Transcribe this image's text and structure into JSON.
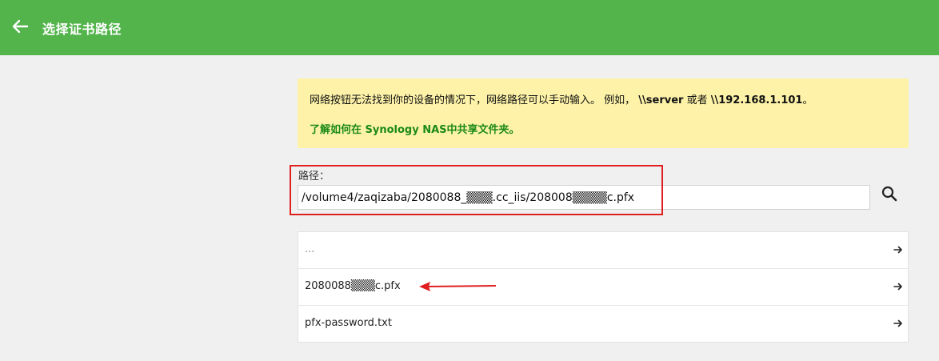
{
  "header": {
    "back_icon": "arrow-left-icon",
    "title": "选择证书路径",
    "bg_color": "#52b44b"
  },
  "notice": {
    "text_before": "网络按钮无法找到你的设备的情况下，网络路径可以手动输入。 例如， ",
    "example1": "\\\\server",
    "text_middle": " 或者 ",
    "example2": "\\\\192.168.1.101",
    "text_end": "。",
    "link": "了解如何在 Synology NAS中共享文件夹。"
  },
  "path": {
    "label": "路径：",
    "value": "/volume4/zaqizaba/2080088_▒▒▒.cc_iis/208008▒▒▒▒c.pfx",
    "search_icon": "search-icon"
  },
  "files": [
    {
      "name": "...",
      "arrow_icon": "arrow-right-icon"
    },
    {
      "name": "2080088▒▒▒c.pfx",
      "arrow_icon": "arrow-right-icon"
    },
    {
      "name": "pfx-password.txt",
      "arrow_icon": "arrow-right-icon"
    }
  ],
  "annotation": {
    "color": "#e02020"
  }
}
